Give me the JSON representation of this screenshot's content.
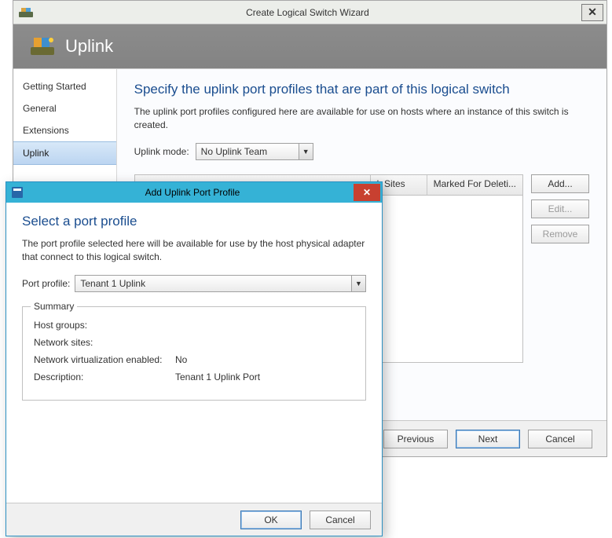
{
  "wizard": {
    "title": "Create Logical Switch Wizard",
    "banner_title": "Uplink",
    "sidebar": {
      "items": [
        {
          "label": "Getting Started"
        },
        {
          "label": "General"
        },
        {
          "label": "Extensions"
        },
        {
          "label": "Uplink"
        }
      ],
      "selected_index": 3
    },
    "main": {
      "heading": "Specify the uplink port profiles that are part of this logical switch",
      "description": "The uplink port profiles configured here are available for use on hosts where an instance of this switch is created.",
      "uplink_mode_label": "Uplink mode:",
      "uplink_mode_value": "No Uplink Team",
      "grid_headers": {
        "col1": "k Sites",
        "col2": "Marked For Deleti..."
      },
      "actions": {
        "add": "Add...",
        "edit": "Edit...",
        "remove": "Remove"
      }
    },
    "footer": {
      "previous": "Previous",
      "next": "Next",
      "cancel": "Cancel"
    }
  },
  "modal": {
    "title": "Add Uplink Port Profile",
    "heading": "Select a port profile",
    "description": "The port profile selected here will be available for use by the host physical adapter that connect to this logical switch.",
    "port_profile_label": "Port profile:",
    "port_profile_value": "Tenant 1 Uplink",
    "summary": {
      "legend": "Summary",
      "host_groups_label": "Host groups:",
      "host_groups_value": "",
      "network_sites_label": "Network sites:",
      "network_sites_value": "",
      "netvirt_label": "Network virtualization enabled:",
      "netvirt_value": "No",
      "description_label": "Description:",
      "description_value": "Tenant 1 Uplink Port"
    },
    "footer": {
      "ok": "OK",
      "cancel": "Cancel"
    }
  }
}
